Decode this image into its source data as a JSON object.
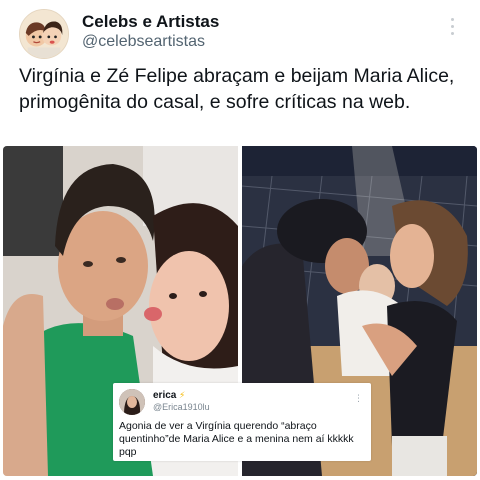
{
  "author": {
    "display_name": "Celebs e Artistas",
    "handle": "@celebseartistas",
    "avatar_icon": "cartoon-couple-avatar"
  },
  "tweet": {
    "text": "Virgínia e Zé Felipe abraçam e beijam Maria Alice, primogênita do casal, e sofre críticas na web."
  },
  "icons": {
    "more": "more-vertical-icon"
  },
  "media": {
    "photos": [
      {
        "name": "couple-selfie-photo"
      },
      {
        "name": "family-kiss-photo"
      }
    ]
  },
  "comment": {
    "name": "erica",
    "badge": "⚡",
    "handle": "@Erica1910lu",
    "more": "⋮",
    "text": "Agonia de ver a Virgínia querendo “abraço quentinho”de Maria Alice e a menina nem aí kkkkk pqp"
  },
  "colors": {
    "text_primary": "#0f1419",
    "text_secondary": "#536471",
    "background": "#ffffff"
  }
}
